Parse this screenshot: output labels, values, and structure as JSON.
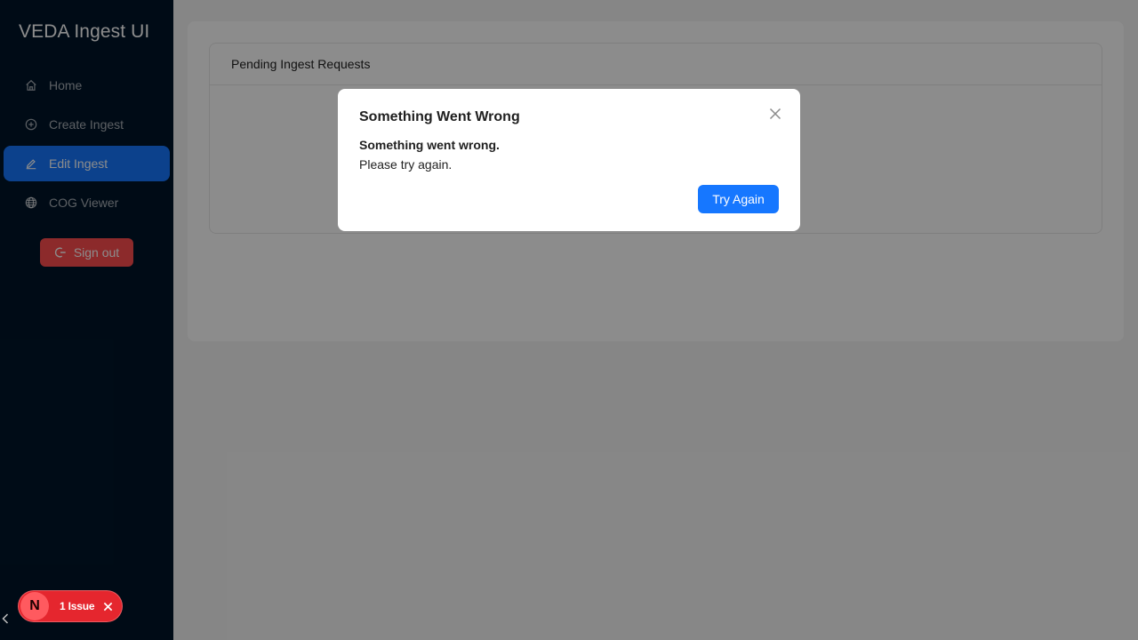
{
  "sidebar": {
    "title": "VEDA Ingest UI",
    "items": [
      {
        "label": "Home",
        "icon": "home-icon"
      },
      {
        "label": "Create Ingest",
        "icon": "plus-circle-icon"
      },
      {
        "label": "Edit Ingest",
        "icon": "edit-icon",
        "active": true
      },
      {
        "label": "COG Viewer",
        "icon": "globe-icon"
      }
    ],
    "signout_label": "Sign out"
  },
  "main": {
    "card_title": "Pending Ingest Requests"
  },
  "modal": {
    "title": "Something Went Wrong",
    "message_bold": "Something went wrong.",
    "message": "Please try again.",
    "button_label": "Try Again"
  },
  "dev_badge": {
    "logo": "N",
    "issues_label": "1 Issue"
  },
  "colors": {
    "sidebar_bg": "#001529",
    "primary": "#1677ff",
    "danger": "#ff4d4f",
    "badge": "#e5262e"
  }
}
